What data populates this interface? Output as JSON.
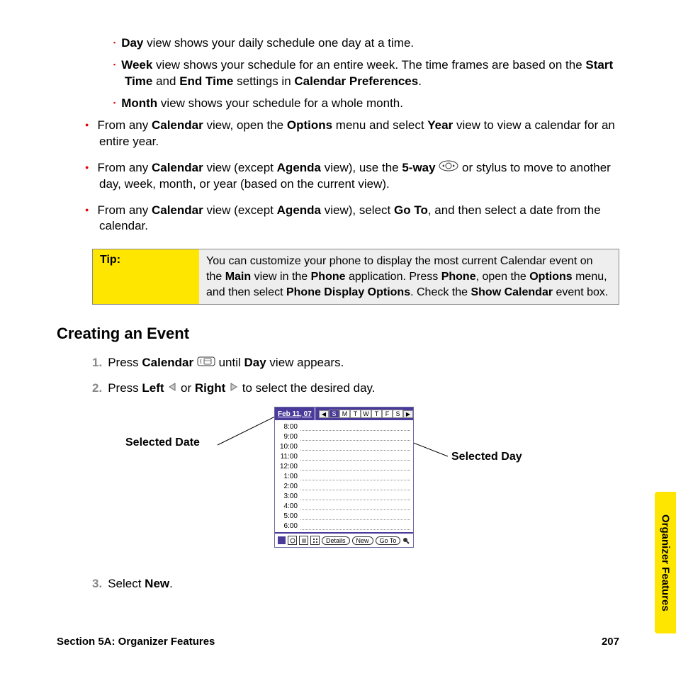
{
  "bullets_sq": [
    {
      "b": "Day",
      "t": " view shows your daily schedule one day at a time."
    },
    {
      "b": "Week",
      "t": " view shows your schedule for an entire week. The time frames are based on the ",
      "b2": "Start Time",
      "t2": " and ",
      "b3": "End Time",
      "t3": " settings in ",
      "b4": "Calendar Preferences",
      "t4": "."
    },
    {
      "b": "Month",
      "t": " view shows your schedule for a whole month."
    }
  ],
  "circ1": {
    "p1": "From any ",
    "b1": "Calendar",
    "p2": " view, open the ",
    "b2": "Options",
    "p3": " menu and select ",
    "b3": "Year",
    "p4": " view to view a calendar for an entire year."
  },
  "circ2": {
    "p1": "From any ",
    "b1": "Calendar",
    "p2": " view (except ",
    "b2": "Agenda",
    "p3": " view), use the ",
    "b3": "5-way",
    "p4": " or stylus to move to another day, week, month, or year (based on the current view)."
  },
  "circ3": {
    "p1": "From any ",
    "b1": "Calendar",
    "p2": " view (except ",
    "b2": "Agenda",
    "p3": " view), select ",
    "b3": "Go To",
    "p4": ", and then select a date from the calendar."
  },
  "tip": {
    "label": "Tip:",
    "p1": "You can customize your phone to display the most current Calendar event on the ",
    "b1": "Main",
    "p2": " view in the ",
    "b2": "Phone",
    "p3": " application. Press ",
    "b3": "Phone",
    "p4": ", open the ",
    "b4": "Options",
    "p5": " menu, and then select ",
    "b5": "Phone Display Options",
    "p6": ". Check the ",
    "b6": "Show Calendar",
    "p7": " event box."
  },
  "heading": "Creating an Event",
  "step1": {
    "n": "1.",
    "p1": "Press ",
    "b1": "Calendar",
    "p2": " until ",
    "b2": "Day",
    "p3": " view appears."
  },
  "step2": {
    "n": "2.",
    "p1": "Press ",
    "b1": "Left",
    "p2": " or ",
    "b2": "Right",
    "p3": " to select the desired day."
  },
  "step3": {
    "n": "3.",
    "p1": "Select ",
    "b1": "New",
    "p2": "."
  },
  "callout_left": "Selected Date",
  "callout_right": "Selected Day",
  "cal": {
    "date": "Feb 11, 07",
    "dow": [
      "S",
      "M",
      "T",
      "W",
      "T",
      "F",
      "S"
    ],
    "sel_dow": 0,
    "times": [
      "8:00",
      "9:00",
      "10:00",
      "11:00",
      "12:00",
      "1:00",
      "2:00",
      "3:00",
      "4:00",
      "5:00",
      "6:00"
    ],
    "btn_details": "Details",
    "btn_new": "New",
    "btn_goto": "Go To"
  },
  "footer": {
    "section": "Section 5A: Organizer Features",
    "page": "207"
  },
  "sidetab": "Organizer Features"
}
